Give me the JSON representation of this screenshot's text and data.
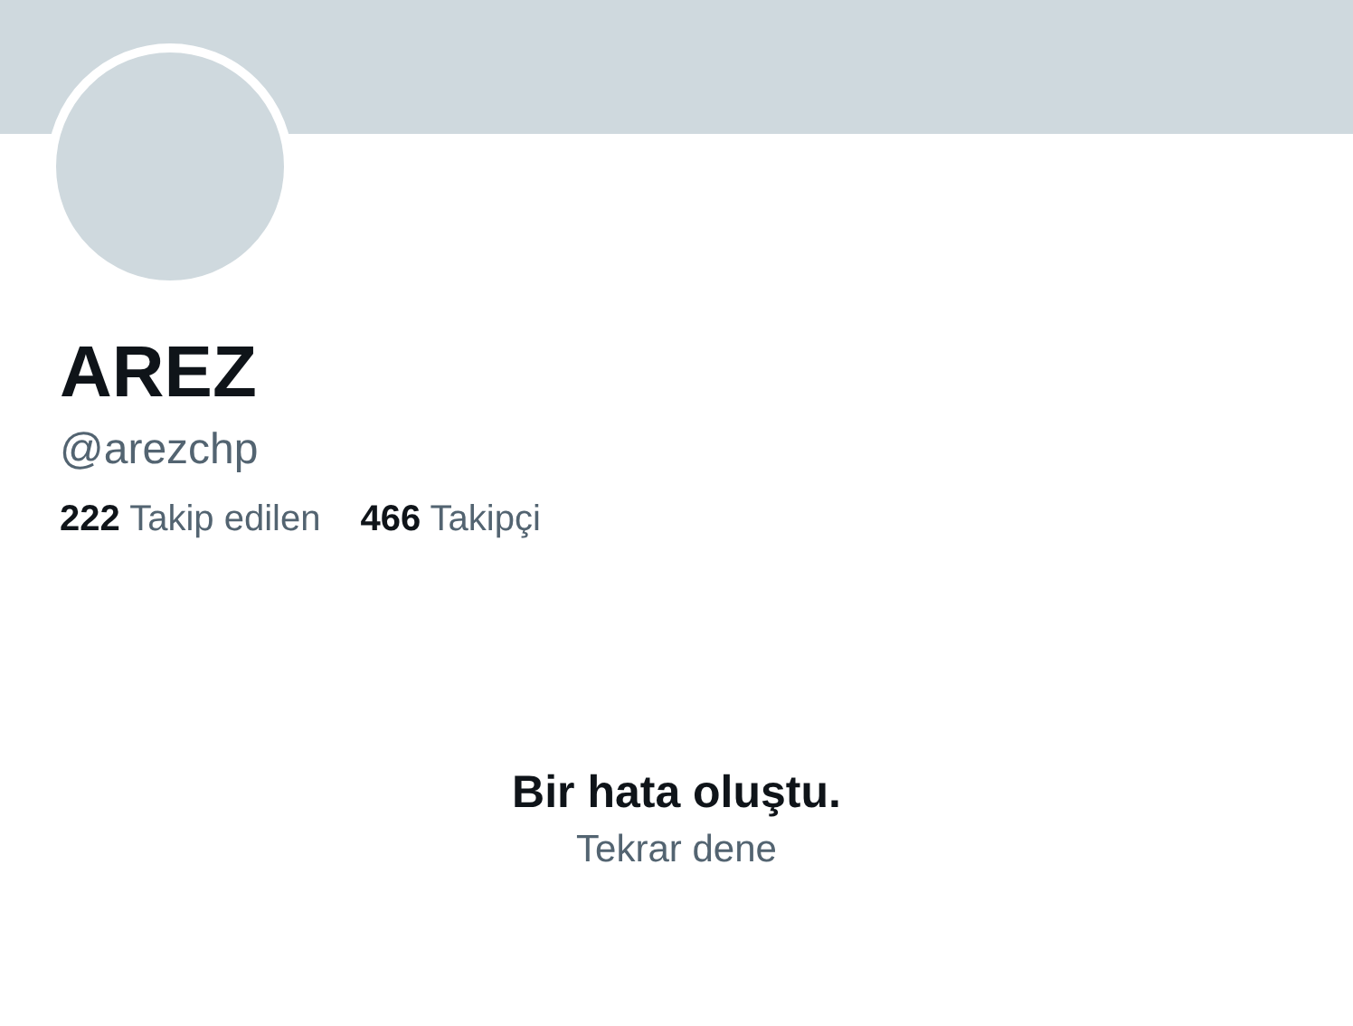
{
  "profile": {
    "name": "AREZ",
    "handle": "@arezchp"
  },
  "stats": [
    {
      "text": "**222** Takip edilen"
    },
    {
      "text": "**466** Takipçi"
    }
  ],
  "error": {
    "message": "Bir hata oluştu.",
    "retry": "Tekrar dene"
  }
}
